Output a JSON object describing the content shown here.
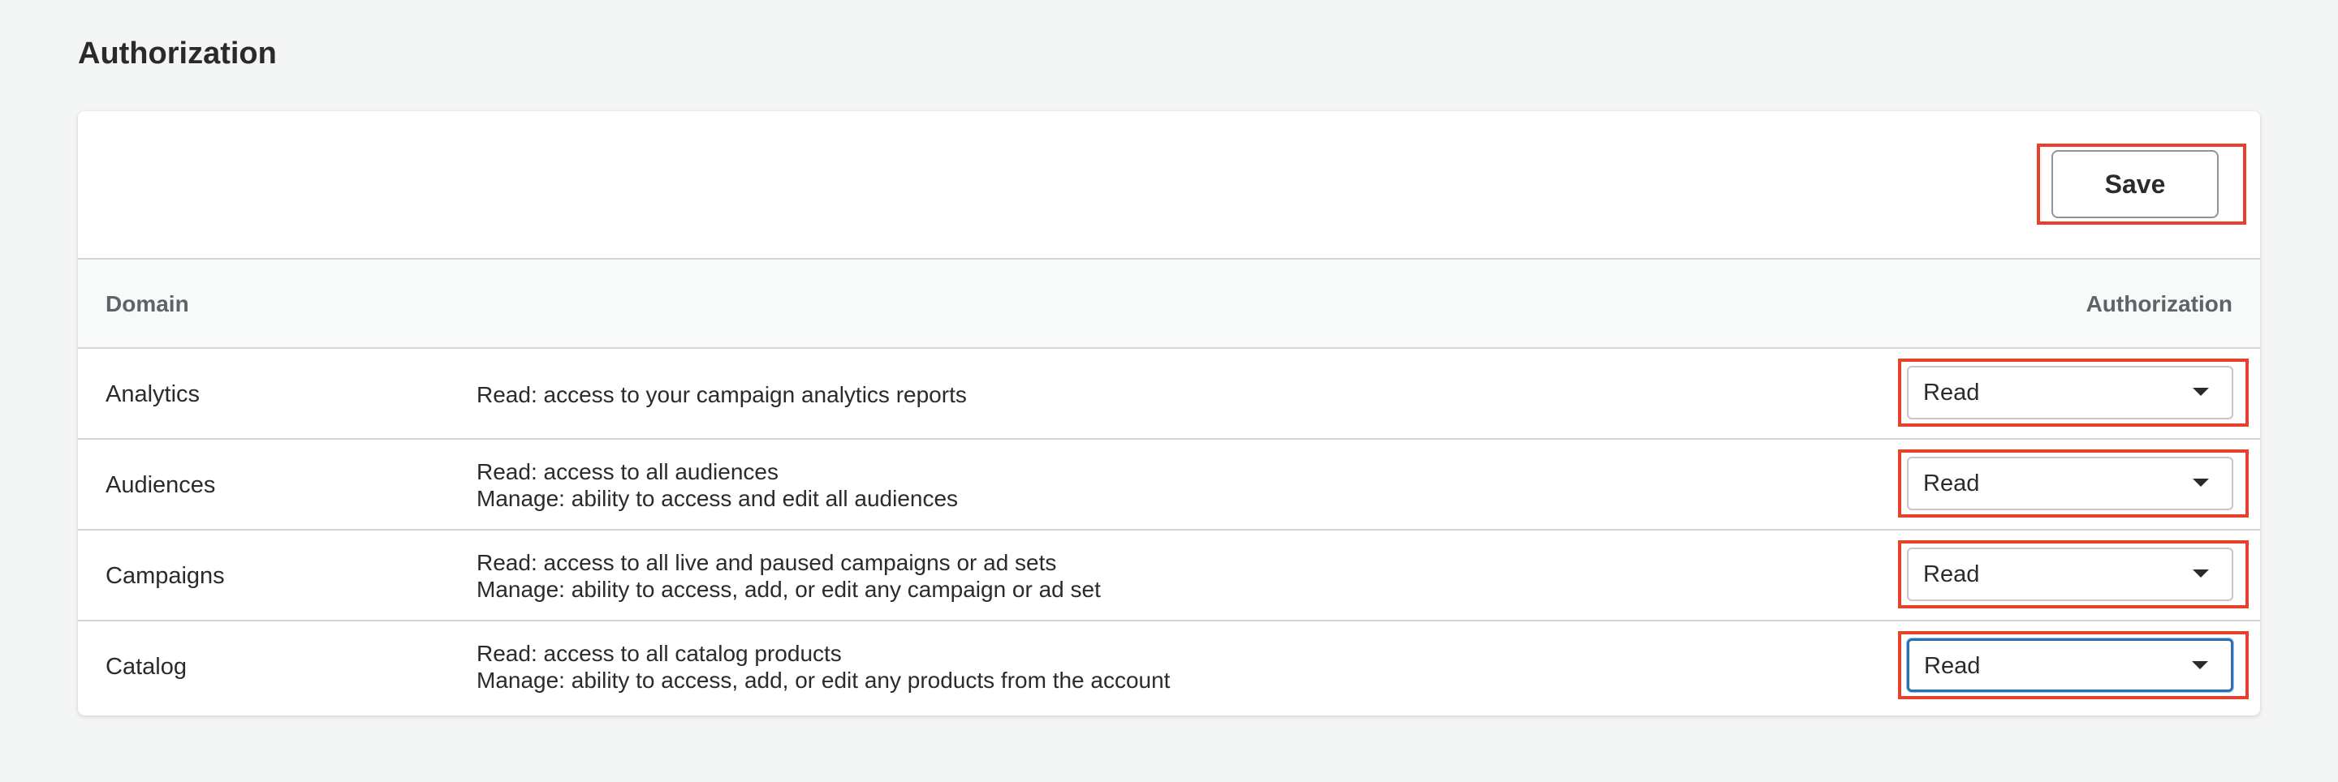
{
  "page": {
    "title": "Authorization"
  },
  "toolbar": {
    "save_label": "Save"
  },
  "table": {
    "columns": {
      "domain": "Domain",
      "authorization": "Authorization"
    },
    "rows": [
      {
        "domain": "Analytics",
        "lines": [
          "Read: access to your campaign analytics reports"
        ],
        "authorization": "Read"
      },
      {
        "domain": "Audiences",
        "lines": [
          "Read: access to all audiences",
          "Manage: ability to access and edit all audiences"
        ],
        "authorization": "Read"
      },
      {
        "domain": "Campaigns",
        "lines": [
          "Read: access to all live and paused campaigns or ad sets",
          "Manage: ability to access, add, or edit any campaign or ad set"
        ],
        "authorization": "Read"
      },
      {
        "domain": "Catalog",
        "lines": [
          "Read: access to all catalog products",
          "Manage: ability to access, add, or edit any products from the account"
        ],
        "authorization": "Read"
      }
    ]
  },
  "colors": {
    "highlight": "#e8402a",
    "focus": "#2a6fb0",
    "background": "#f4f5f5"
  }
}
